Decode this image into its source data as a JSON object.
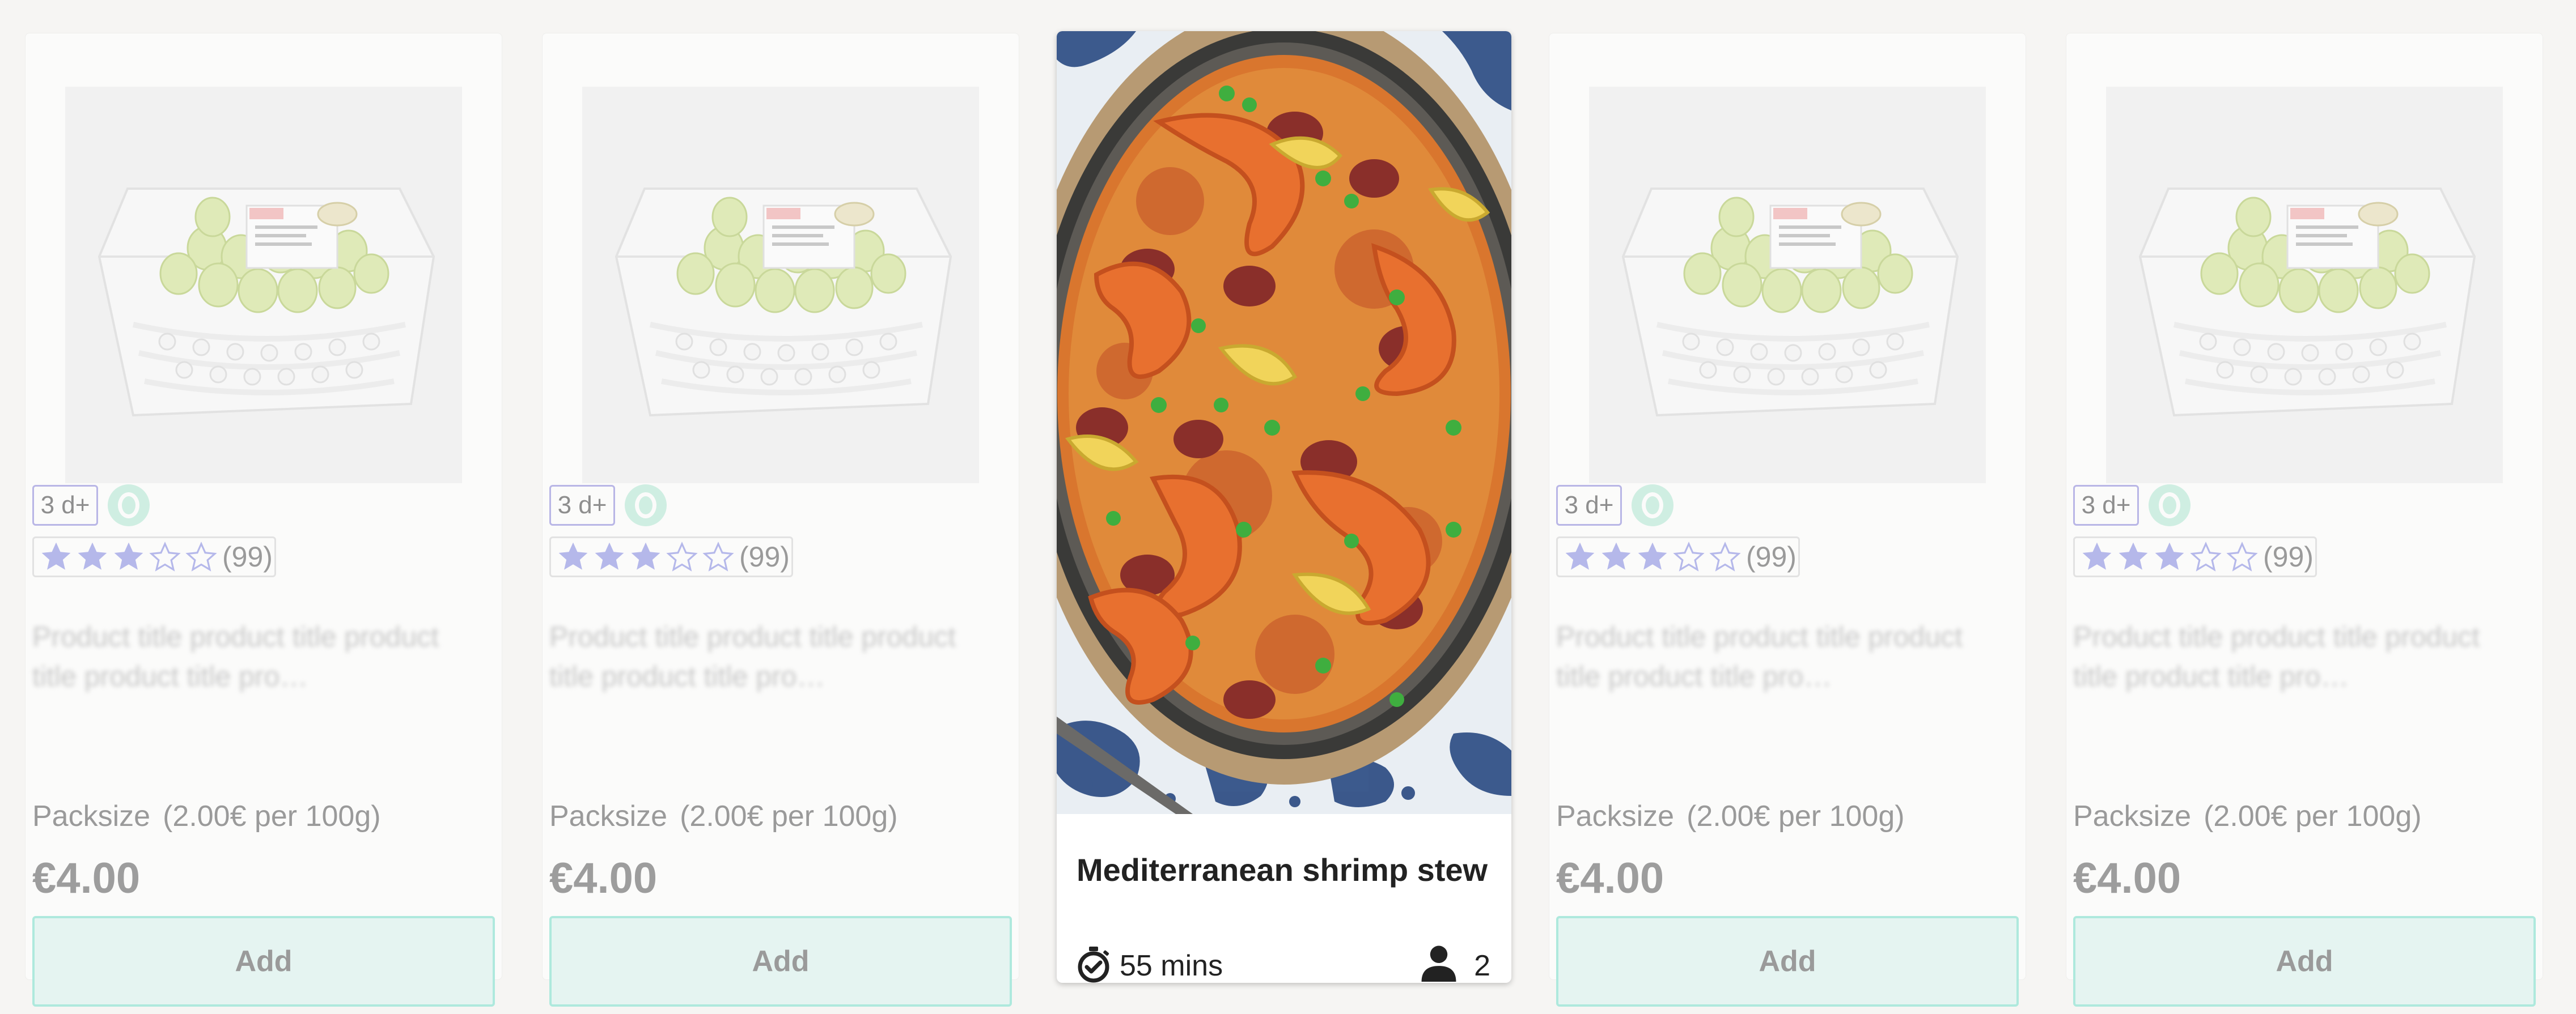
{
  "products": [
    {
      "age_badge": "3 d+",
      "rating_count": "(99)",
      "title": "Product title product title product title product title pro…",
      "packsize": "Packsize",
      "unit_price": "(2.00€ per 100g)",
      "price": "€4.00",
      "add_label": "Add",
      "stars_filled": 3,
      "stars_total": 5
    },
    {
      "age_badge": "3 d+",
      "rating_count": "(99)",
      "title": "Product title product title product title product title pro…",
      "packsize": "Packsize",
      "unit_price": "(2.00€ per 100g)",
      "price": "€4.00",
      "add_label": "Add",
      "stars_filled": 3,
      "stars_total": 5
    },
    {
      "age_badge": "3 d+",
      "rating_count": "(99)",
      "title": "Product title product title product title product title pro…",
      "packsize": "Packsize",
      "unit_price": "(2.00€ per 100g)",
      "price": "€4.00",
      "add_label": "Add",
      "stars_filled": 3,
      "stars_total": 5
    },
    {
      "age_badge": "3 d+",
      "rating_count": "(99)",
      "title": "Product title product title product title product title pro…",
      "packsize": "Packsize",
      "unit_price": "(2.00€ per 100g)",
      "price": "€4.00",
      "add_label": "Add",
      "stars_filled": 3,
      "stars_total": 5
    }
  ],
  "recipe": {
    "title": "Mediterranean shrimp stew",
    "time": "55 mins",
    "servings": "2",
    "timer_icon": "timer-icon",
    "person_icon": "person-icon"
  },
  "colors": {
    "star_filled": "#b5b8ea",
    "badge_border": "#b9b6e6",
    "add_bg": "#e5f4f1",
    "add_border": "#aee9dd",
    "page_bg": "#f6f5f3"
  }
}
